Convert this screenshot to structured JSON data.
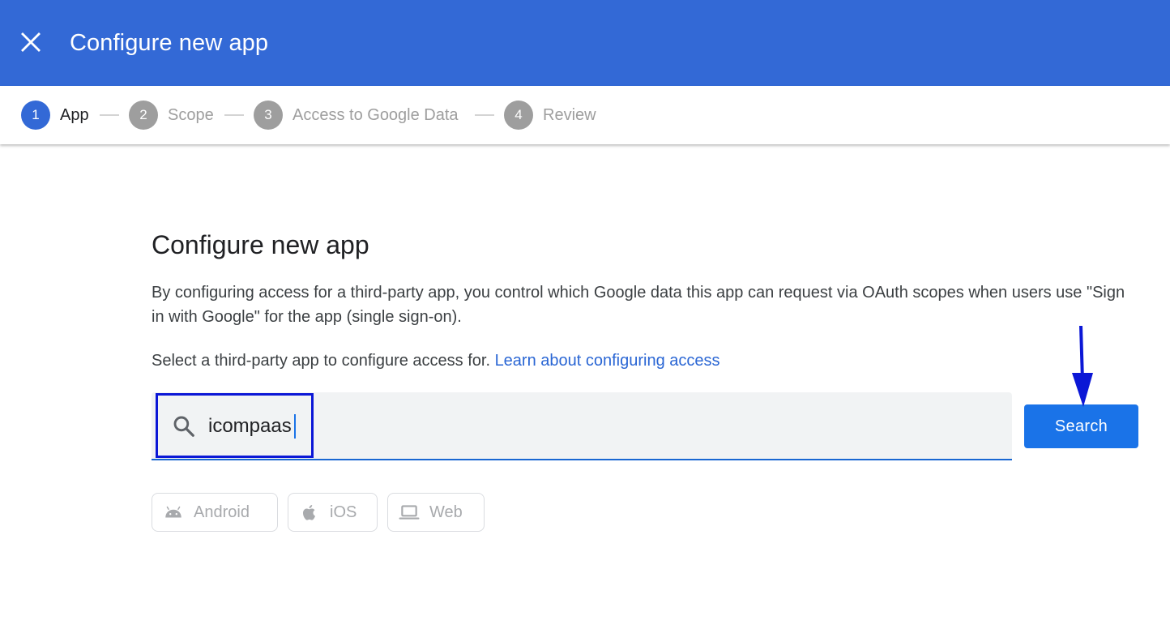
{
  "header": {
    "title": "Configure new app",
    "close_icon": "close-icon",
    "background_color": "#3369d6"
  },
  "stepper": {
    "steps": [
      {
        "number": "1",
        "label": "App",
        "active": true
      },
      {
        "number": "2",
        "label": "Scope",
        "active": false
      },
      {
        "number": "3",
        "label": "Access to Google Data",
        "active": false
      },
      {
        "number": "4",
        "label": "Review",
        "active": false
      }
    ]
  },
  "main": {
    "title": "Configure new app",
    "description": "By configuring access for a third-party app, you control which Google data this app can request via OAuth scopes when users use \"Sign in with Google\" for the app (single sign-on).",
    "select_prompt": "Select a third-party app to configure access for.",
    "learn_link": "Learn about configuring access",
    "search": {
      "value": "icompaas",
      "icon": "search-icon"
    },
    "search_button": "Search",
    "platform_chips": [
      {
        "label": "Android",
        "icon": "android-icon"
      },
      {
        "label": "iOS",
        "icon": "apple-icon"
      },
      {
        "label": "Web",
        "icon": "laptop-icon"
      }
    ]
  },
  "colors": {
    "accent": "#1a73e8",
    "link": "#2a66d4",
    "annotation": "#0b17d6"
  }
}
